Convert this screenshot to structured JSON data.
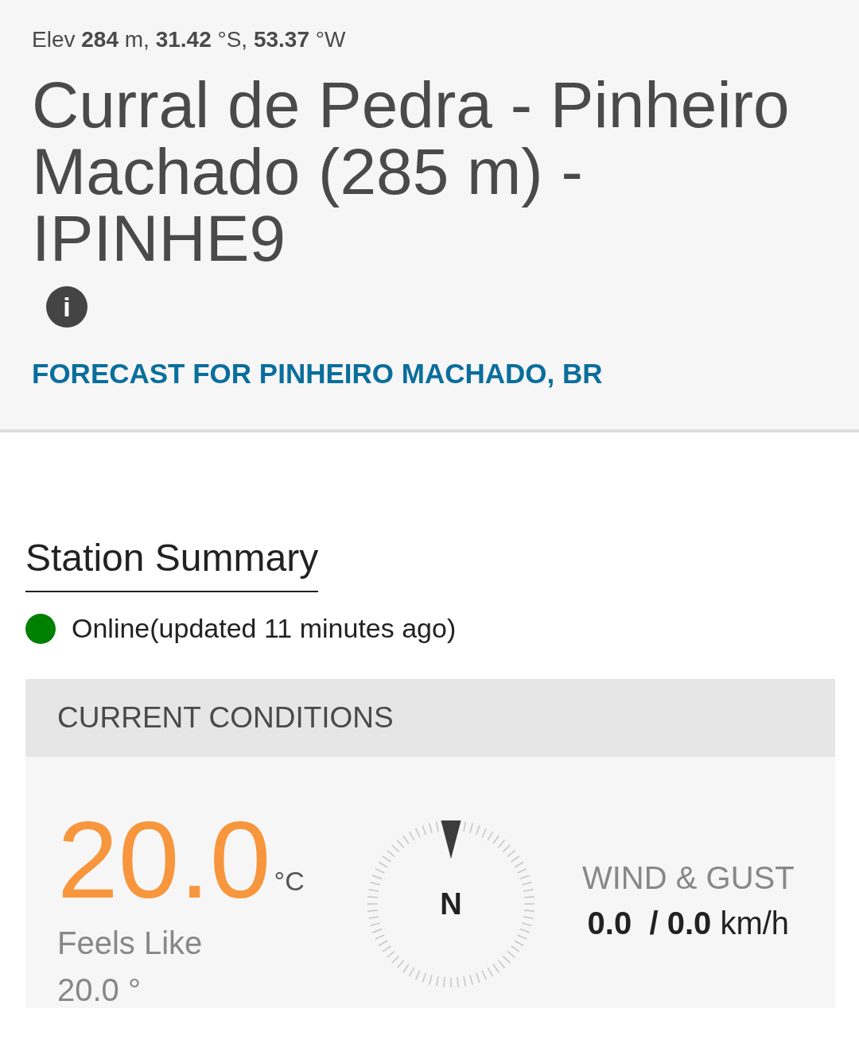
{
  "header": {
    "location_line": "Elev **284** m, **31.42** °S, **53.37** °W",
    "title": "Curral de Pedra - Pinheiro Machado (285 m) - IPINHE9",
    "info_icon": "i",
    "forecast_link": "FORECAST FOR PINHEIRO MACHADO, BR"
  },
  "summary": {
    "heading": "Station Summary",
    "status": {
      "text": "Online(updated 11 minutes ago)",
      "color": "#008000"
    }
  },
  "current_conditions": {
    "heading": "CURRENT CONDITIONS",
    "temperature": {
      "value": "20.0",
      "unit": "°C",
      "feels_like_label": "Feels Like",
      "feels_like_value": "20.0 °"
    },
    "compass": {
      "direction": "N"
    },
    "wind": {
      "label": "WIND & GUST",
      "value": "**0.0  / 0.0** km/h"
    }
  }
}
